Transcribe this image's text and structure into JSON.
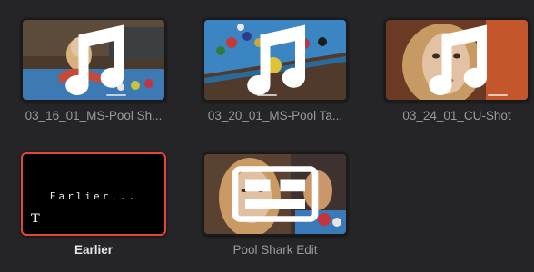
{
  "media_pool": {
    "clips": [
      {
        "name": "03_16_01_MS-Pool Sh...",
        "type": "audio-video-clip",
        "icon": "music-note-icon"
      },
      {
        "name": "03_20_01_MS-Pool Ta...",
        "type": "audio-video-clip",
        "icon": "music-note-icon"
      },
      {
        "name": "03_24_01_CU-Shot",
        "type": "audio-video-clip",
        "icon": "music-note-icon"
      },
      {
        "name": "Earlier",
        "type": "title-clip",
        "icon": "text-title-icon",
        "thumbnail_text": "Earlier...",
        "selected": true
      },
      {
        "name": "Pool Shark Edit",
        "type": "timeline",
        "icon": "timeline-icon"
      }
    ]
  },
  "colors": {
    "background": "#252527",
    "selection": "#e0473a",
    "label_default": "#9a9a9c",
    "label_selected": "#e4e4e6"
  }
}
